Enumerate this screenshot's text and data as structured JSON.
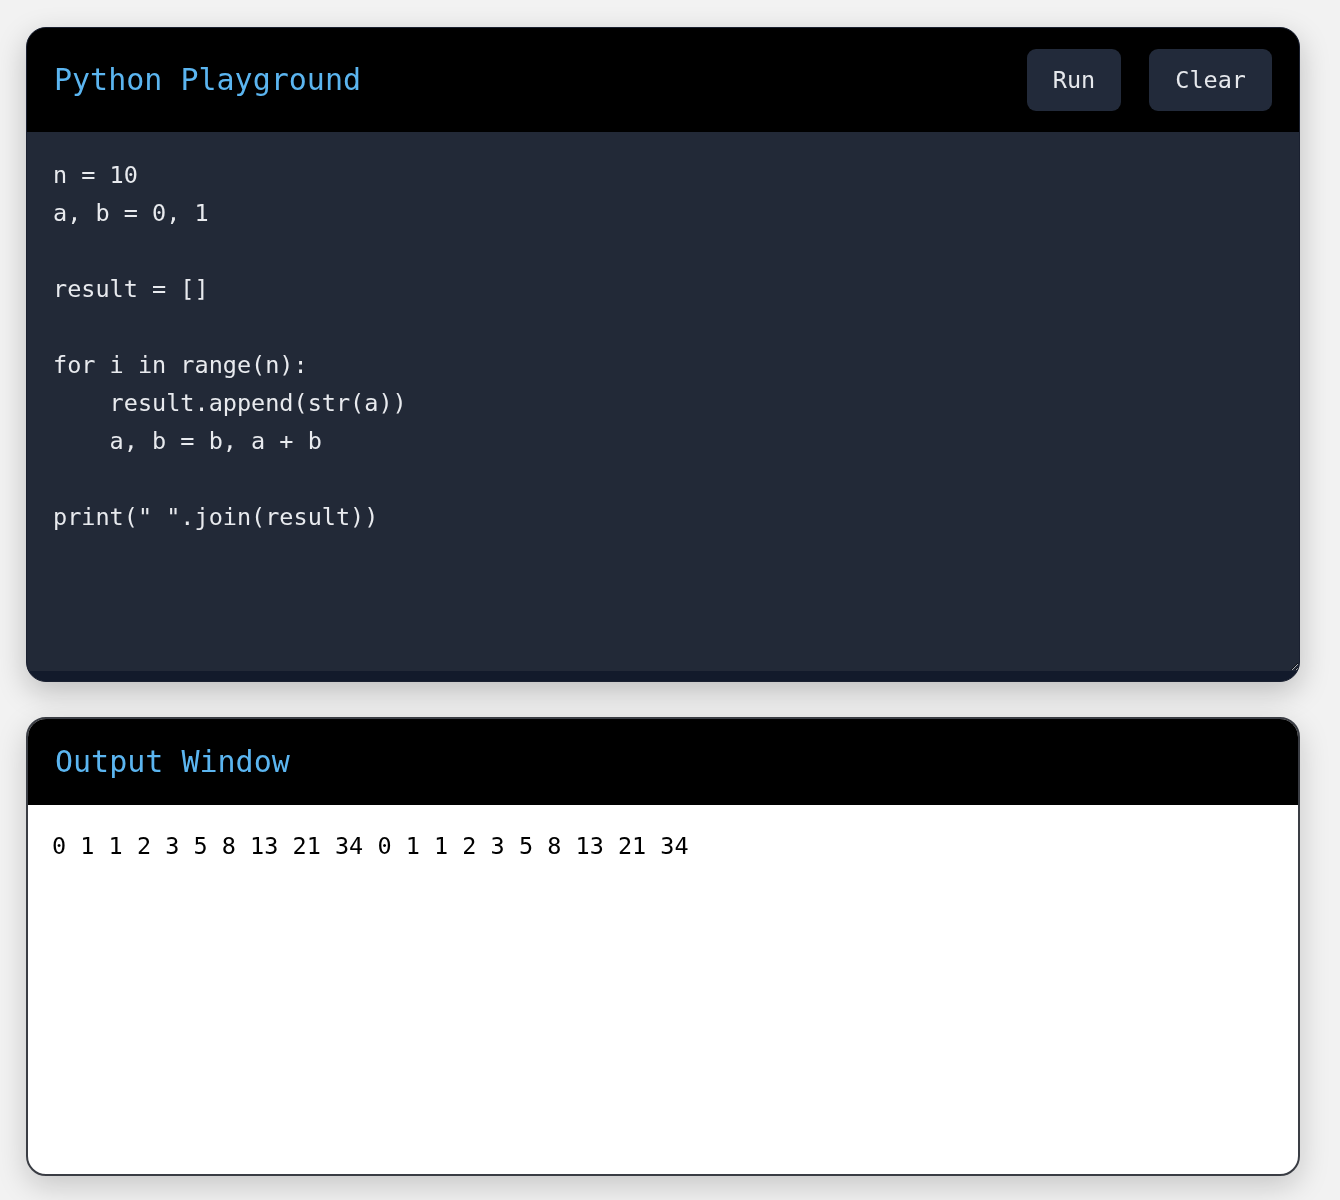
{
  "editor": {
    "title": "Python Playground",
    "buttons": [
      "Run",
      "Clear"
    ],
    "code": "n = 10\na, b = 0, 1\n\nresult = []\n\nfor i in range(n):\n    result.append(str(a))\n    a, b = b, a + b\n\nprint(\" \".join(result))"
  },
  "output": {
    "title": "Output Window",
    "text": "0 1 1 2 3 5 8 13 21 34 0 1 1 2 3 5 8 13 21 34"
  }
}
